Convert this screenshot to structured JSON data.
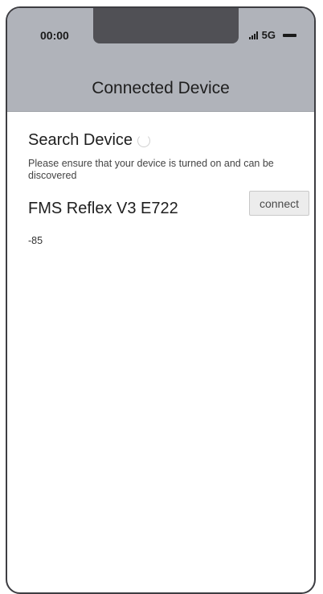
{
  "status_bar": {
    "time": "00:00",
    "network": "5G"
  },
  "header": {
    "title": "Connected Device"
  },
  "search": {
    "title": "Search Device",
    "hint": "Please ensure that your device is turned on and can be discovered"
  },
  "devices": [
    {
      "name": "FMS Reflex V3 E722",
      "rssi": "-85",
      "connect_label": "connect"
    }
  ],
  "colors": {
    "header_bg": "#b0b3ba",
    "notch": "#505055",
    "button_bg": "#ececec"
  },
  "icons": [
    "signal-icon",
    "battery-icon",
    "spinner-icon"
  ]
}
